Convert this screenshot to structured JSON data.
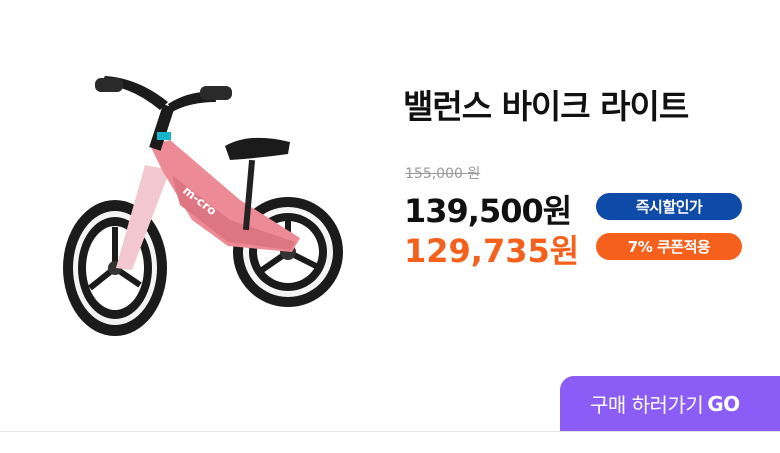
{
  "product": {
    "title": "밸런스 바이크 라이트",
    "image_name": "micro balance bike pink",
    "frame_text": "m-cro",
    "original_price": "155,000 원",
    "sale_price": "139,500원",
    "coupon_price": "129,735원"
  },
  "badges": {
    "discount_label": "즉시할인가",
    "coupon_label": "7% 쿠폰적용"
  },
  "cta": {
    "label": "구매 하러가기",
    "go": "GO"
  },
  "colors": {
    "frame": "#ec8b95",
    "discount_badge": "#0e4aa7",
    "coupon_accent": "#f5611c",
    "cta": "#8b5cf6"
  }
}
